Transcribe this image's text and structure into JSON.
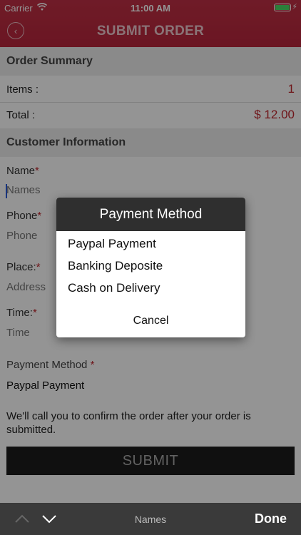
{
  "status": {
    "carrier": "Carrier",
    "time": "11:00 AM"
  },
  "nav": {
    "title": "SUBMIT ORDER",
    "back_icon": "chevron-left-circle-icon"
  },
  "order_summary": {
    "heading": "Order Summary",
    "items_label": "Items :",
    "items_value": "1",
    "total_label": "Total :",
    "total_value": "$ 12.00"
  },
  "customer": {
    "heading": "Customer Information",
    "name_label": "Name",
    "name_placeholder": "Names",
    "phone_label": "Phone",
    "phone_placeholder": "Phone",
    "place_label": "Place:",
    "place_placeholder": "Address",
    "time_label": "Time:",
    "time_placeholder": "Time",
    "required_mark": "*"
  },
  "payment": {
    "label": "Payment Method ",
    "required_mark": "*",
    "value": "Paypal Payment"
  },
  "info_text": "We'll call you to confirm the order after your order is submitted.",
  "submit_label": "SUBMIT",
  "keyboard_bar": {
    "field_name": "Names",
    "done_label": "Done"
  },
  "modal": {
    "title": "Payment Method",
    "options": [
      "Paypal Payment",
      "Banking Deposite",
      "Cash on Delivery"
    ],
    "cancel_label": "Cancel"
  },
  "colors": {
    "nav_red": "#b8263c",
    "accent_red": "#c0262e",
    "caret_blue": "#2a5bd7"
  }
}
